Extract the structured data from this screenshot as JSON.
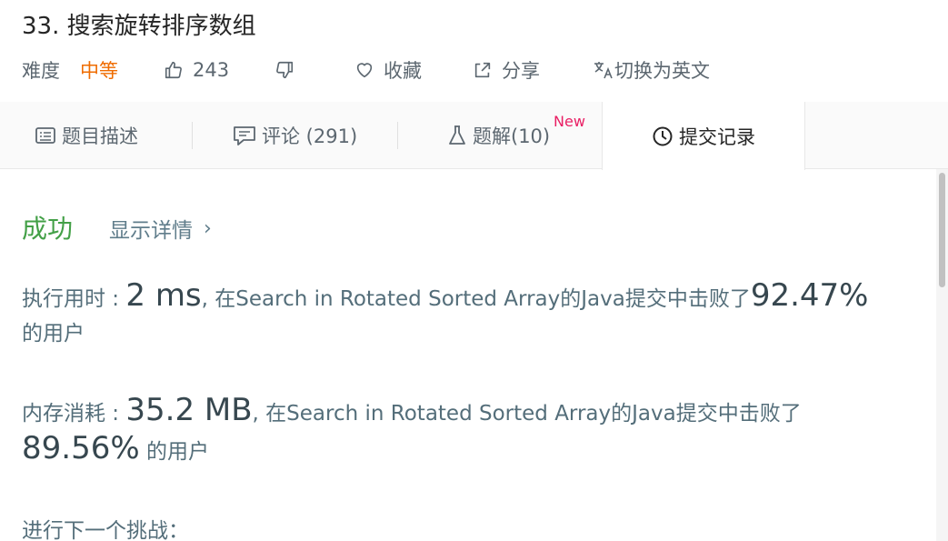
{
  "problem": {
    "title": "33. 搜索旋转排序数组",
    "difficulty_label": "难度",
    "difficulty_value": "中等",
    "likes": "243",
    "collect_label": "收藏",
    "share_label": "分享",
    "language_switch_label": "切换为英文"
  },
  "tabs": [
    {
      "label": "题目描述"
    },
    {
      "label": "评论 (291)"
    },
    {
      "label": "题解(10)"
    },
    {
      "label": "提交记录"
    }
  ],
  "new_badge": "New",
  "result": {
    "status": "成功",
    "detail_link": "显示详情",
    "detail_chevron": "›",
    "runtime_prefix": "执行用时 : ",
    "runtime_value": "2 ms",
    "runtime_middle": ", 在Search in Rotated Sorted Array的Java提交中击败了",
    "runtime_percent": "92.47%",
    "runtime_suffix": "的用户",
    "memory_prefix": "内存消耗 : ",
    "memory_value": "35.2 MB",
    "memory_middle": ", 在Search in Rotated Sorted Array的Java提交中击败了",
    "memory_percent": "89.56%",
    "memory_suffix": " 的用户",
    "next_challenge": "进行下一个挑战："
  },
  "colors": {
    "difficulty_medium": "#ef6c00",
    "success": "#43a047",
    "new_badge": "#e91e63"
  },
  "icons": {
    "like": "thumbs-up-icon",
    "dislike": "thumbs-down-icon",
    "collect": "heart-icon",
    "share": "share-icon",
    "language": "translate-icon",
    "tab_desc": "description-icon",
    "tab_comments": "comment-icon",
    "tab_solutions": "flask-icon",
    "tab_submissions": "clock-icon"
  }
}
